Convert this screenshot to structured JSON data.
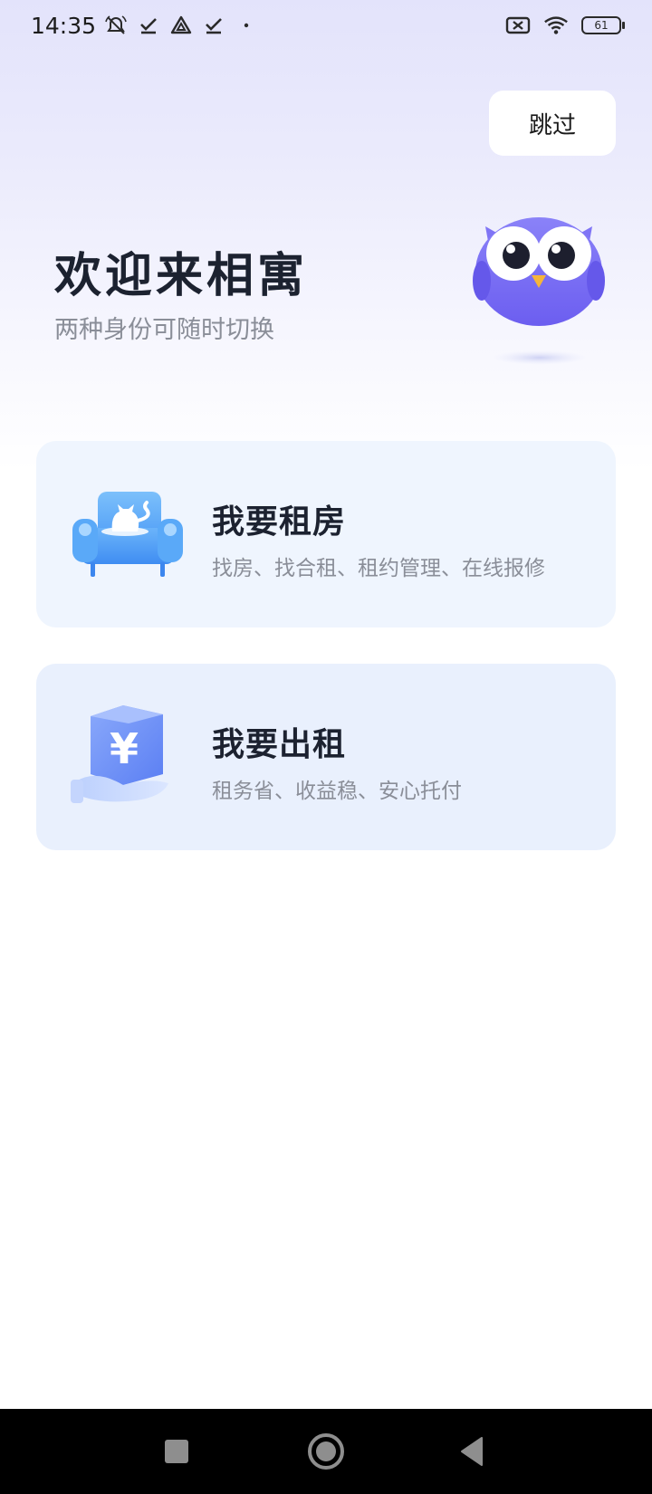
{
  "status_bar": {
    "time": "14:35",
    "left_icons": [
      "alarm-off-icon",
      "check-icon",
      "drive-icon",
      "check-icon",
      "dot-icon"
    ],
    "right_icons": [
      "no-sim-icon",
      "wifi-icon",
      "battery-icon"
    ],
    "battery_level": "61"
  },
  "header": {
    "skip_label": "跳过"
  },
  "hero": {
    "title": "欢迎来相寓",
    "subtitle": "两种身份可随时切换",
    "mascot": "owl-mascot-icon"
  },
  "options": [
    {
      "title": "我要租房",
      "description": "找房、找合租、租约管理、在线报修",
      "icon": "sofa-icon",
      "bg_color": "#eff5fe"
    },
    {
      "title": "我要出租",
      "description": "租务省、收益稳、安心托付",
      "icon": "yuan-hand-icon",
      "bg_color": "#e9f0fd"
    }
  ],
  "nav_bar": {
    "buttons": [
      "recents-button",
      "home-button",
      "back-button"
    ]
  },
  "colors": {
    "accent_purple": "#7b6ef6",
    "accent_blue": "#5aa6f8",
    "title_text": "#1c2230",
    "secondary_text": "#8a8e98"
  }
}
